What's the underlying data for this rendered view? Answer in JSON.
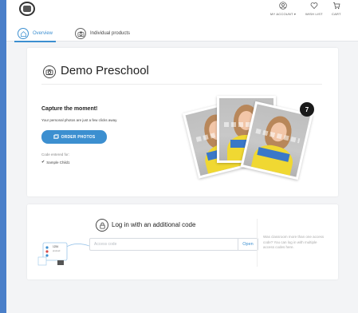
{
  "header": {
    "my_account": "MY ACCOUNT",
    "my_account_caret": "▾",
    "wish_list": "WISH LIST",
    "cart": "CART"
  },
  "tabs": [
    {
      "label": "Overview",
      "active": true
    },
    {
      "label": "Individual products",
      "active": false
    }
  ],
  "school": {
    "title": "Demo Preschool"
  },
  "capture": {
    "title": "Capture the moment!",
    "subtitle": "Your personal photos are just a few clicks away.",
    "order_button": "ORDER PHOTOS",
    "code_entered_label": "Code entered for:",
    "child_name": "Sample Child1",
    "photo_count": "7"
  },
  "login": {
    "title": "Log in with an additional code",
    "placeholder": "Access code",
    "open_button": "Open",
    "help_text": "Was classroom more than one access code? You can log in with multiple access codes here."
  },
  "illustration": {
    "card_label": "1234",
    "card_sublabel": "preload"
  },
  "colors": {
    "accent": "#3c8fd0",
    "outer_background": "#4a7fc9",
    "page_background": "#f3f4f6"
  }
}
